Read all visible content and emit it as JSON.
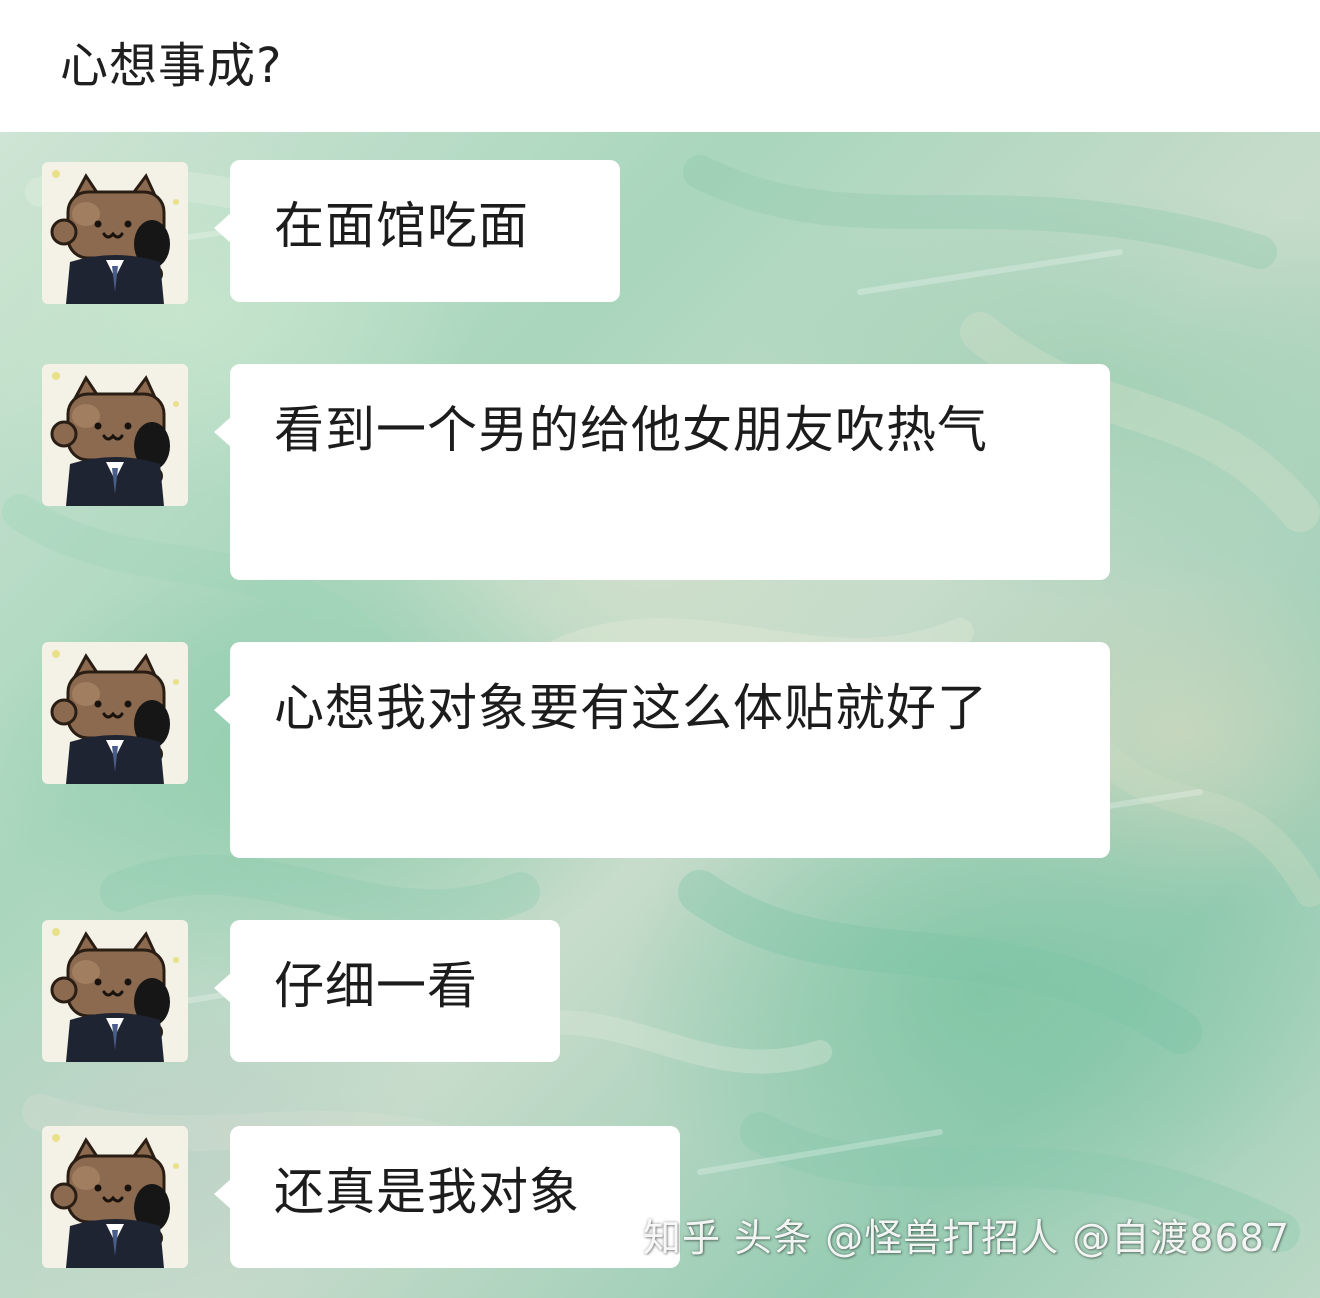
{
  "header": {
    "title": "心想事成?"
  },
  "messages": [
    {
      "text": "在面馆吃面",
      "avatar_icon": "cat-avatar-icon"
    },
    {
      "text": "看到一个男的给他女朋友吹热气",
      "avatar_icon": "cat-avatar-icon"
    },
    {
      "text": "心想我对象要有这么体贴就好了",
      "avatar_icon": "cat-avatar-icon"
    },
    {
      "text": "仔细一看",
      "avatar_icon": "cat-avatar-icon"
    },
    {
      "text": "还真是我对象",
      "avatar_icon": "cat-avatar-icon"
    }
  ],
  "watermark": {
    "text": "知乎 头条 @怪兽打招人 @自渡8687"
  },
  "colors": {
    "bubble": "#ffffff",
    "chat_background": "#a9d6bd",
    "avatar_fur": "#8b6a4f",
    "avatar_suit": "#1f2433"
  }
}
